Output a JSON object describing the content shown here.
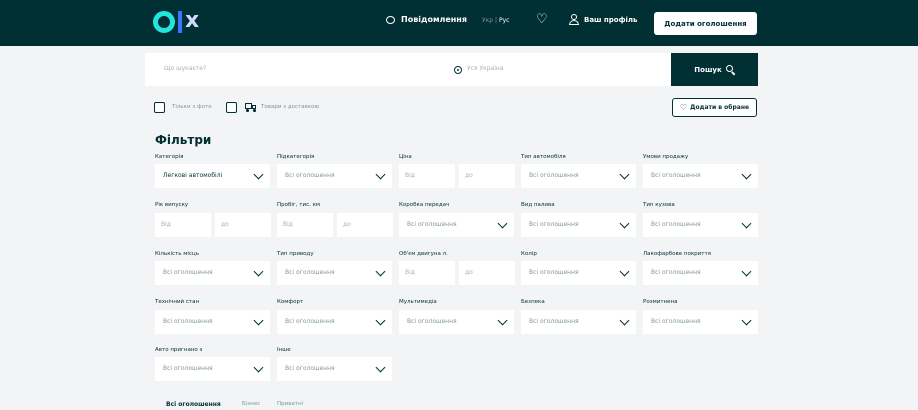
{
  "header": {
    "messages_label": "Повідомлення",
    "lang_active": "Укр",
    "lang_sep": "|",
    "lang_other": "Рус",
    "profile_label": "Ваш профіль",
    "add_ad_label": "Додати оголошення"
  },
  "search": {
    "query_placeholder": "Що шукаєте?",
    "location_placeholder": "Уся Україна",
    "button_label": "Пошук"
  },
  "options": {
    "photo_only": "Тільки з фото",
    "with_delivery": "Товари з доставкою",
    "add_favorite": "Додати в обране"
  },
  "filters": {
    "title": "Фільтри",
    "category": {
      "label": "Категорія",
      "value": "Легкові автомобілі"
    },
    "subcategory": {
      "label": "Підкатегорія",
      "value": "Всі оголошення"
    },
    "price": {
      "label": "Ціна",
      "from": "Від",
      "to": "до"
    },
    "car_type": {
      "label": "Тип автомобіля",
      "value": "Всі оголошення"
    },
    "sale_terms": {
      "label": "Умови продажу",
      "value": "Всі оголошення"
    },
    "year": {
      "label": "Рік випуску",
      "from": "Від",
      "to": "до"
    },
    "mileage": {
      "label": "Пробіг, тис. км",
      "from": "Від",
      "to": "до"
    },
    "gearbox": {
      "label": "Коробка передач",
      "value": "Всі оголошення"
    },
    "fuel": {
      "label": "Вид палива",
      "value": "Всі оголошення"
    },
    "body_type": {
      "label": "Тип кузова",
      "value": "Всі оголошення"
    },
    "seats": {
      "label": "Кількість місць",
      "value": "Всі оголошення"
    },
    "drive": {
      "label": "Тип приводу",
      "value": "Всі оголошення"
    },
    "engine": {
      "label": "Об'єм двигуна л.",
      "from": "Від",
      "to": "до"
    },
    "color": {
      "label": "Колір",
      "value": "Всі оголошення"
    },
    "paint": {
      "label": "Лакофарбове покриття",
      "value": "Всі оголошення"
    },
    "condition": {
      "label": "Технічний стан",
      "value": "Всі оголошення"
    },
    "comfort": {
      "label": "Комфорт",
      "value": "Всі оголошення"
    },
    "multimedia": {
      "label": "Мультимедіа",
      "value": "Всі оголошення"
    },
    "safety": {
      "label": "Безпека",
      "value": "Всі оголошення"
    },
    "customs": {
      "label": "Розмитнена",
      "value": "Всі оголошення"
    },
    "origin": {
      "label": "Авто пригнано з",
      "value": "Всі оголошення"
    },
    "other": {
      "label": "Інше",
      "value": "Всі оголошення"
    }
  },
  "tabs": {
    "all": "Всі оголошення",
    "business": "Бізнес",
    "private": "Приватні"
  }
}
